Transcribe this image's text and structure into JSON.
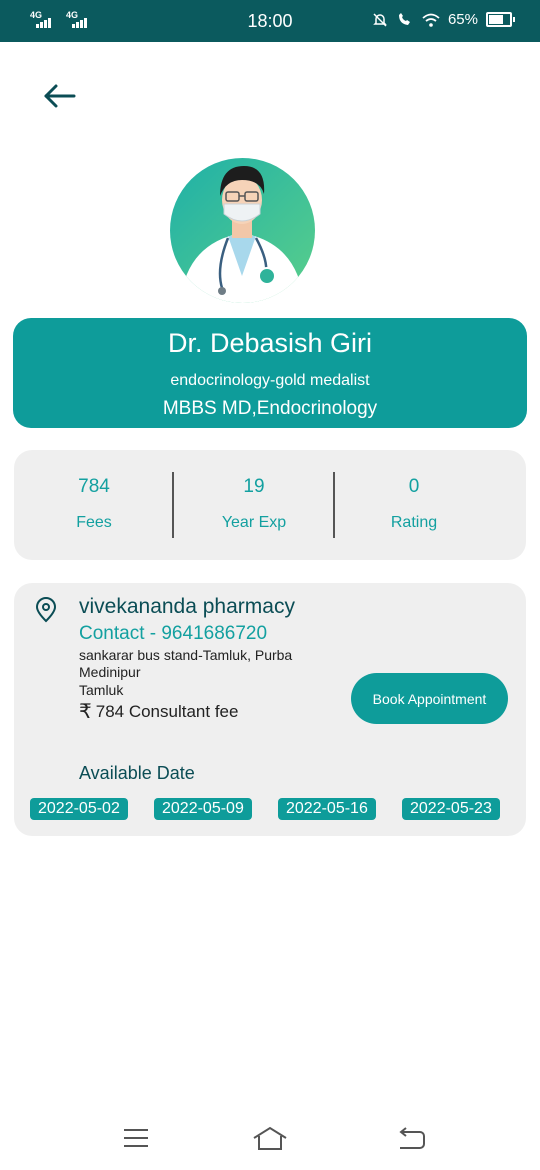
{
  "status_bar": {
    "signal_1": "4G",
    "signal_2": "4G",
    "time": "18:00",
    "battery": "65%",
    "icons": [
      "mute-bell-icon",
      "volte-icon",
      "wifi-icon",
      "battery-icon"
    ]
  },
  "header": {
    "back_icon": "arrow-left-icon"
  },
  "doctor": {
    "name": "Dr. Debasish Giri",
    "specialization": "endocrinology-gold medalist",
    "degree": "MBBS MD,Endocrinology"
  },
  "stats": [
    {
      "value": "784",
      "label": "Fees"
    },
    {
      "value": "19",
      "label": "Year Exp"
    },
    {
      "value": "0",
      "label": "Rating"
    }
  ],
  "clinic": {
    "name": "vivekananda pharmacy",
    "contact": "Contact - 9641686720",
    "address": "sankarar bus stand-Tamluk, Purba Medinipur",
    "city": "Tamluk",
    "fee_text": "784 Consultant fee",
    "book_button": "Book Appointment",
    "available_label": "Available Date",
    "dates": [
      "2022-05-02",
      "2022-05-09",
      "2022-05-16",
      "2022-05-23"
    ]
  },
  "nav": {
    "icons": [
      "menu-icon",
      "home-icon",
      "back-nav-icon"
    ]
  },
  "colors": {
    "primary": "#0e9c9a",
    "status_bar": "#0b5a5e",
    "card_bg": "#efefef",
    "title_text": "#0b4d55"
  }
}
